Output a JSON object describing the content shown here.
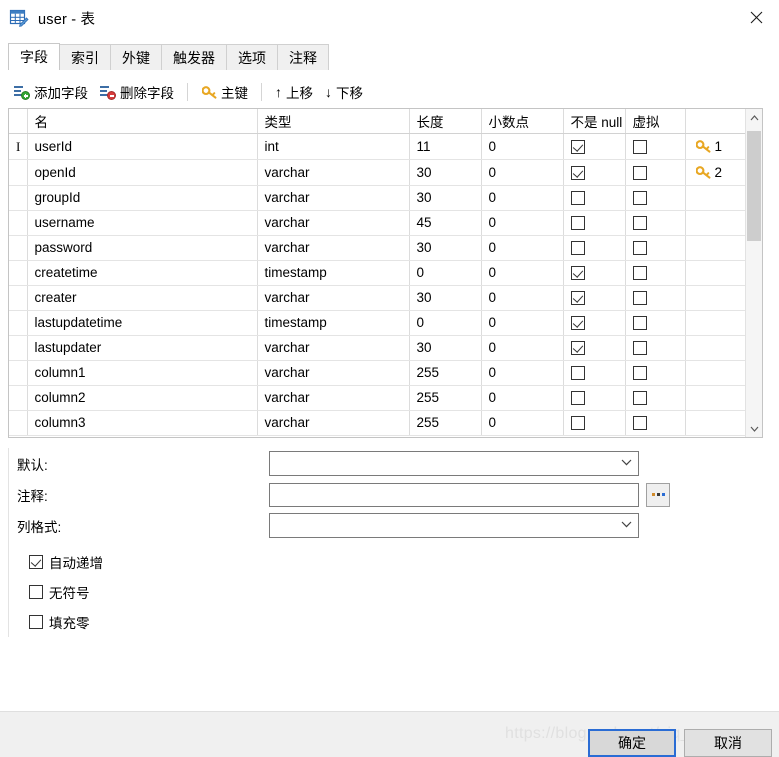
{
  "window": {
    "title": "user - 表",
    "icon": "table-edit-icon",
    "close_label": "✕"
  },
  "tabs": [
    {
      "label": "字段",
      "active": true
    },
    {
      "label": "索引",
      "active": false
    },
    {
      "label": "外键",
      "active": false
    },
    {
      "label": "触发器",
      "active": false
    },
    {
      "label": "选项",
      "active": false
    },
    {
      "label": "注释",
      "active": false
    }
  ],
  "toolbar": {
    "add_field": "添加字段",
    "delete_field": "删除字段",
    "primary_key": "主键",
    "move_up": "上移",
    "move_down": "下移",
    "move_up_glyph": "↑",
    "move_down_glyph": "↓"
  },
  "grid": {
    "columns": [
      "名",
      "类型",
      "长度",
      "小数点",
      "不是 null",
      "虚拟",
      ""
    ],
    "rows": [
      {
        "name": "userId",
        "type": "int",
        "length": "11",
        "decimals": "0",
        "not_null": true,
        "virtual": false,
        "key": "1",
        "selected": true
      },
      {
        "name": "openId",
        "type": "varchar",
        "length": "30",
        "decimals": "0",
        "not_null": true,
        "virtual": false,
        "key": "2",
        "selected": false
      },
      {
        "name": "groupId",
        "type": "varchar",
        "length": "30",
        "decimals": "0",
        "not_null": false,
        "virtual": false,
        "key": "",
        "selected": false
      },
      {
        "name": "username",
        "type": "varchar",
        "length": "45",
        "decimals": "0",
        "not_null": false,
        "virtual": false,
        "key": "",
        "selected": false
      },
      {
        "name": "password",
        "type": "varchar",
        "length": "30",
        "decimals": "0",
        "not_null": false,
        "virtual": false,
        "key": "",
        "selected": false
      },
      {
        "name": "createtime",
        "type": "timestamp",
        "length": "0",
        "decimals": "0",
        "not_null": true,
        "virtual": false,
        "key": "",
        "selected": false
      },
      {
        "name": "creater",
        "type": "varchar",
        "length": "30",
        "decimals": "0",
        "not_null": true,
        "virtual": false,
        "key": "",
        "selected": false
      },
      {
        "name": "lastupdatetime",
        "type": "timestamp",
        "length": "0",
        "decimals": "0",
        "not_null": true,
        "virtual": false,
        "key": "",
        "selected": false
      },
      {
        "name": "lastupdater",
        "type": "varchar",
        "length": "30",
        "decimals": "0",
        "not_null": true,
        "virtual": false,
        "key": "",
        "selected": false
      },
      {
        "name": "column1",
        "type": "varchar",
        "length": "255",
        "decimals": "0",
        "not_null": false,
        "virtual": false,
        "key": "",
        "selected": false
      },
      {
        "name": "column2",
        "type": "varchar",
        "length": "255",
        "decimals": "0",
        "not_null": false,
        "virtual": false,
        "key": "",
        "selected": false
      },
      {
        "name": "column3",
        "type": "varchar",
        "length": "255",
        "decimals": "0",
        "not_null": false,
        "virtual": false,
        "key": "",
        "selected": false
      }
    ],
    "scroll_up_glyph": "︿",
    "scroll_down_glyph": "﹀"
  },
  "details": {
    "default_label": "默认:",
    "default_value": "",
    "comment_label": "注释:",
    "comment_value": "",
    "column_format_label": "列格式:",
    "column_format_value": "",
    "browse_button": "...",
    "caret_glyph": "⌄",
    "checkboxes": [
      {
        "label": "自动递增",
        "checked": true
      },
      {
        "label": "无符号",
        "checked": false
      },
      {
        "label": "填充零",
        "checked": false
      }
    ]
  },
  "footer": {
    "ok_label": "确定",
    "cancel_label": "取消"
  },
  "watermark": "https://blog.csdn.net/zjq_supperman",
  "colors": {
    "accent": "#2a6cd4",
    "key_gold": "#e8a723",
    "add_green": "#34a835",
    "delete_red": "#d83b3b",
    "icon_blue": "#3d6ea5"
  }
}
